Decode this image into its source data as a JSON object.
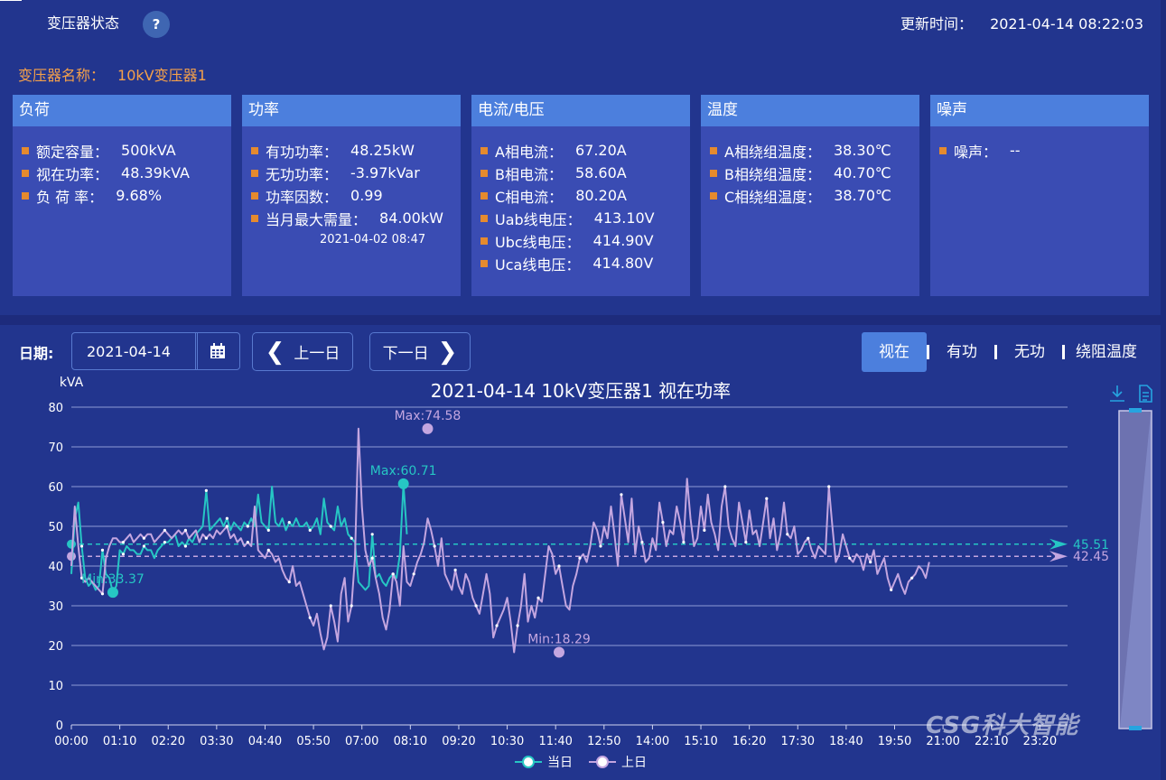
{
  "header": {
    "title": "变压器状态",
    "help_icon": "question-icon",
    "update_label": "更新时间：",
    "update_time": "2021-04-14 08:22:03"
  },
  "transformer": {
    "name_label": "变压器名称：",
    "name": "10kV变压器1"
  },
  "cards": {
    "load": {
      "title": "负荷",
      "items": [
        {
          "label": "额定容量：",
          "value": "500kVA"
        },
        {
          "label": "视在功率：",
          "value": "48.39kVA"
        },
        {
          "label": "负 荷 率：",
          "value": "9.68%"
        }
      ]
    },
    "power": {
      "title": "功率",
      "items": [
        {
          "label": "有功功率：",
          "value": "48.25kW"
        },
        {
          "label": "无功功率：",
          "value": "-3.97kVar"
        },
        {
          "label": "功率因数：",
          "value": "0.99"
        },
        {
          "label": "当月最大需量：",
          "value": "84.00kW"
        }
      ],
      "demand_time": "2021-04-02 08:47"
    },
    "current": {
      "title": "电流/电压",
      "items": [
        {
          "label": "A相电流：",
          "value": "67.20A"
        },
        {
          "label": "B相电流：",
          "value": "58.60A"
        },
        {
          "label": "C相电流：",
          "value": "80.20A"
        },
        {
          "label": "Uab线电压：",
          "value": "413.10V"
        },
        {
          "label": "Ubc线电压：",
          "value": "414.90V"
        },
        {
          "label": "Uca线电压：",
          "value": "414.80V"
        }
      ]
    },
    "temp": {
      "title": "温度",
      "items": [
        {
          "label": "A相绕组温度：",
          "value": "38.30℃"
        },
        {
          "label": "B相绕组温度：",
          "value": "40.70℃"
        },
        {
          "label": "C相绕组温度：",
          "value": "38.70℃"
        }
      ]
    },
    "noise": {
      "title": "噪声",
      "items": [
        {
          "label": "噪声：",
          "value": "--"
        }
      ]
    }
  },
  "toolbar": {
    "date_label": "日期:",
    "date_value": "2021-04-14",
    "prev_label": "上一日",
    "next_label": "下一日",
    "tabs": [
      "视在",
      "有功",
      "无功",
      "绕阻温度"
    ],
    "active_tab": "视在"
  },
  "logo_text": "CSG科大智能",
  "colors": {
    "today": "#26c6c4",
    "yesterday": "#c4a6e0",
    "accent": "#4c7fdd",
    "bullet": "#e58a2e"
  },
  "chart_data": {
    "type": "line",
    "title": "2021-04-14  10kV变压器1  视在功率",
    "ylabel": "kVA",
    "ylim": [
      0,
      80
    ],
    "yticks": [
      0,
      10,
      20,
      30,
      40,
      50,
      60,
      70,
      80
    ],
    "xticks": [
      "00:00",
      "01:10",
      "02:20",
      "03:30",
      "04:40",
      "05:50",
      "07:00",
      "08:10",
      "09:20",
      "10:30",
      "11:40",
      "12:50",
      "14:00",
      "15:10",
      "16:20",
      "17:30",
      "18:40",
      "19:50",
      "21:00",
      "22:10",
      "23:20"
    ],
    "legend": [
      "当日",
      "上日"
    ],
    "series": [
      {
        "name": "当日",
        "color": "#26c6c4",
        "step_minutes": 5,
        "values": [
          38,
          52,
          56,
          45,
          37,
          35,
          36,
          34,
          35,
          44,
          38,
          37,
          33.37,
          35,
          44,
          43,
          45,
          44,
          44,
          43,
          43,
          45,
          44,
          44,
          42,
          44,
          45,
          46,
          46,
          47,
          48,
          45,
          46,
          45,
          47,
          46,
          48,
          49,
          50,
          59,
          49,
          50,
          51,
          52,
          50,
          52,
          49,
          51,
          50,
          49,
          51,
          50,
          52,
          50,
          58,
          51,
          50,
          49,
          60,
          51,
          50,
          52,
          49,
          51,
          50,
          52,
          50,
          50,
          51,
          49,
          50,
          52,
          48,
          57,
          51,
          50,
          49,
          55,
          50,
          52,
          48,
          47,
          46,
          36,
          35,
          34,
          35,
          48,
          37,
          38,
          36,
          35,
          37,
          38,
          37,
          43,
          60.71,
          48
        ]
      },
      {
        "name": "上日",
        "color": "#c4a6e0",
        "step_minutes": 5,
        "values": [
          40,
          55,
          45,
          37,
          36,
          37,
          36,
          35,
          34,
          33,
          42,
          45,
          47,
          47,
          46,
          46,
          47,
          48,
          46,
          47,
          48,
          47,
          48,
          48,
          46,
          47,
          48,
          49,
          48,
          47,
          48,
          49,
          48,
          49,
          47,
          48,
          49,
          46,
          48,
          47,
          48,
          47,
          49,
          48,
          49,
          50,
          47,
          48,
          46,
          47,
          45,
          46,
          45,
          55,
          44,
          43,
          42,
          44,
          43,
          41,
          42,
          39,
          37,
          36,
          40,
          35,
          36,
          33,
          30,
          27,
          25,
          28,
          23,
          19,
          22,
          30,
          26,
          21,
          33,
          37,
          26,
          30,
          42,
          74.58,
          55,
          44,
          40,
          42,
          37,
          33,
          27,
          24,
          29,
          38,
          36,
          30,
          45,
          36,
          35,
          38,
          41,
          43,
          46,
          52,
          49,
          45,
          40,
          47,
          38,
          36,
          34,
          39,
          35,
          33,
          38,
          36,
          32,
          30,
          28,
          33,
          38,
          33,
          22,
          25,
          27,
          29,
          32,
          26,
          18.29,
          25,
          30,
          38,
          26,
          30,
          27,
          32,
          31,
          38,
          45,
          43,
          38,
          40,
          35,
          30,
          29,
          35,
          38,
          42,
          43,
          41,
          45,
          51,
          49,
          45,
          50,
          47,
          55,
          48,
          40,
          58,
          52,
          46,
          57,
          43,
          50,
          46,
          41,
          42,
          47,
          44,
          56,
          51,
          45,
          49,
          48,
          55,
          51,
          46,
          62,
          52,
          45,
          47,
          55,
          49,
          58,
          51,
          48,
          44,
          55,
          60,
          50,
          47,
          45,
          56,
          51,
          46,
          54,
          48,
          49,
          45,
          51,
          57,
          47,
          52,
          44,
          48,
          56,
          48,
          47,
          50,
          43,
          44,
          46,
          47,
          44,
          42,
          45,
          44,
          43,
          60,
          50,
          41,
          43,
          48,
          45,
          42,
          41,
          43,
          42,
          39,
          43,
          41,
          44,
          38,
          40,
          42,
          37,
          34,
          36,
          38,
          35,
          33,
          36,
          37,
          38,
          40,
          39,
          37,
          41
        ]
      }
    ],
    "annotations": [
      {
        "series": "当日",
        "label": "Max:60.71",
        "x": "08:00",
        "y": 60.71
      },
      {
        "series": "当日",
        "label": "Min:33.37",
        "x": "01:00",
        "y": 33.37
      },
      {
        "series": "上日",
        "label": "Max:74.58",
        "x": "08:35",
        "y": 74.58
      },
      {
        "series": "上日",
        "label": "Min:18.29",
        "x": "11:45",
        "y": 18.29
      },
      {
        "series": "当日",
        "label": "45.51",
        "type": "average",
        "y": 45.51
      },
      {
        "series": "上日",
        "label": "42.45",
        "type": "average",
        "y": 42.45
      }
    ]
  }
}
